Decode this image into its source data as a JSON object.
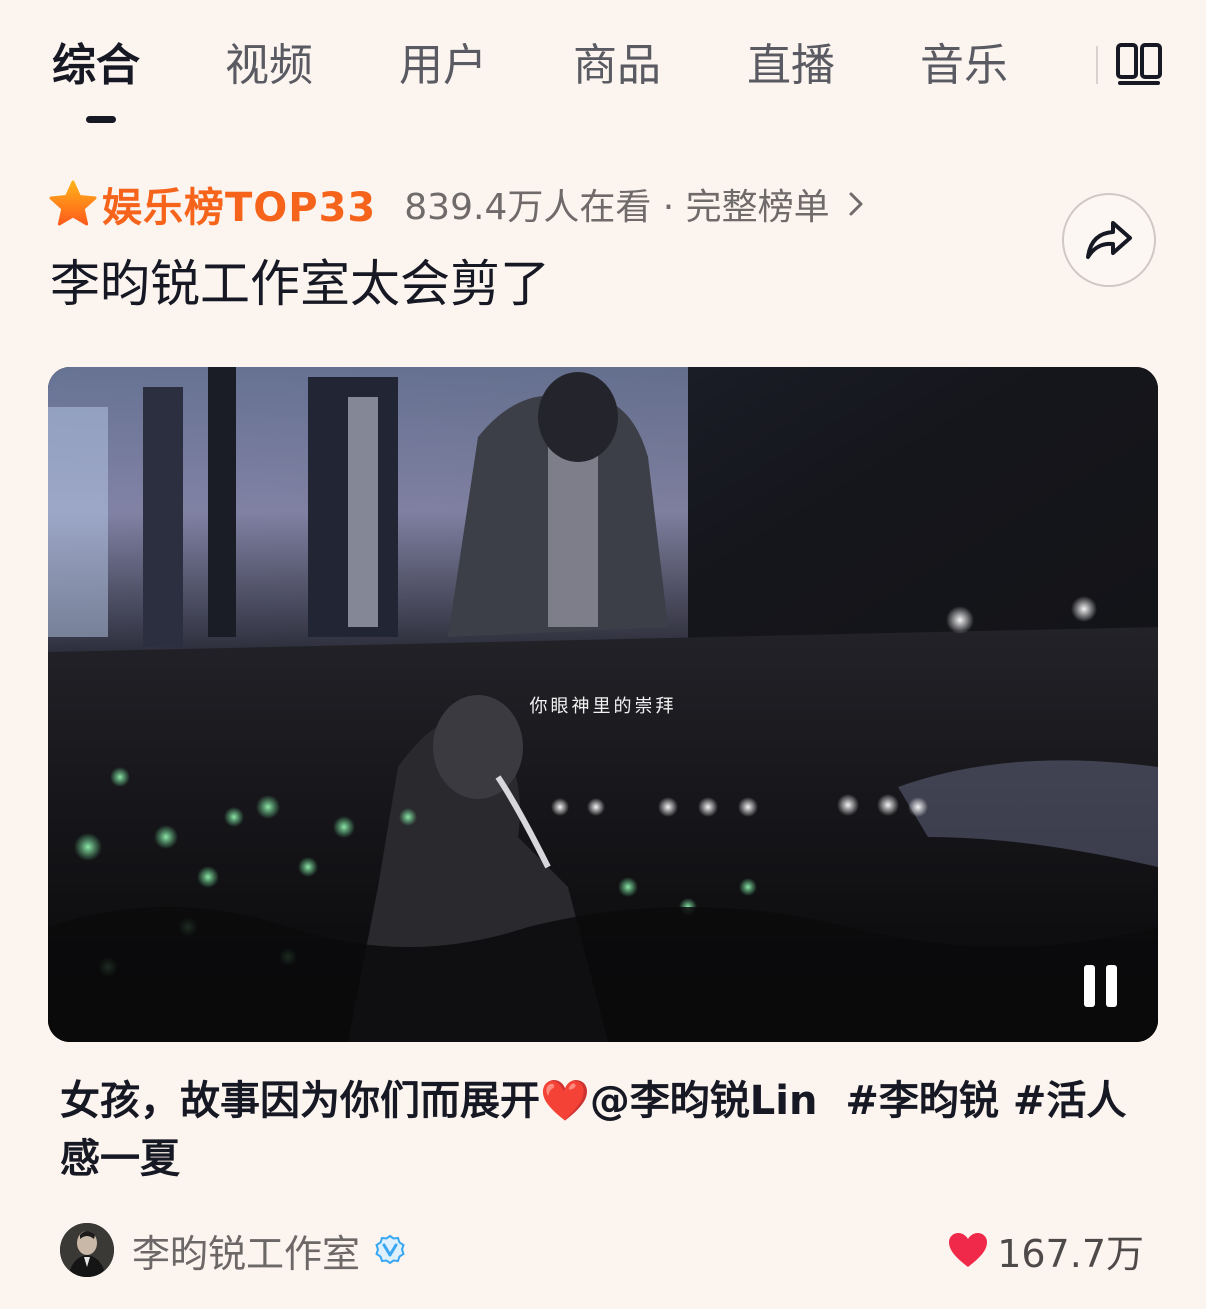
{
  "tabs": [
    {
      "label": "综合"
    },
    {
      "label": "视频"
    },
    {
      "label": "用户"
    },
    {
      "label": "商品"
    },
    {
      "label": "直播"
    },
    {
      "label": "音乐"
    }
  ],
  "active_tab": "综合",
  "rank": {
    "label": "娱乐榜TOP33",
    "meta": "839.4万人在看 · 完整榜单"
  },
  "headline": "李昀锐工作室太会剪了",
  "video": {
    "subtitle": "你眼神里的崇拜",
    "state": "playing"
  },
  "caption": {
    "text_main": "女孩，故事因为你们而展开",
    "emoji": "❤️",
    "mention": "@李昀锐Lin",
    "hashtag_1": "#李昀锐",
    "hashtag_2": "#活人感一夏"
  },
  "author": {
    "name": "李昀锐工作室",
    "verified": true
  },
  "likes": {
    "count": "167.7万"
  },
  "colors": {
    "background": "#fcf4ef",
    "rank_accent": "#f5641a",
    "like_heart": "#f0294a",
    "verified_blue": "#3aa7f2"
  },
  "icons": [
    "star-icon",
    "chevron-right-icon",
    "share-icon",
    "grid-icon",
    "pause-icon",
    "verified-icon",
    "heart-icon"
  ]
}
